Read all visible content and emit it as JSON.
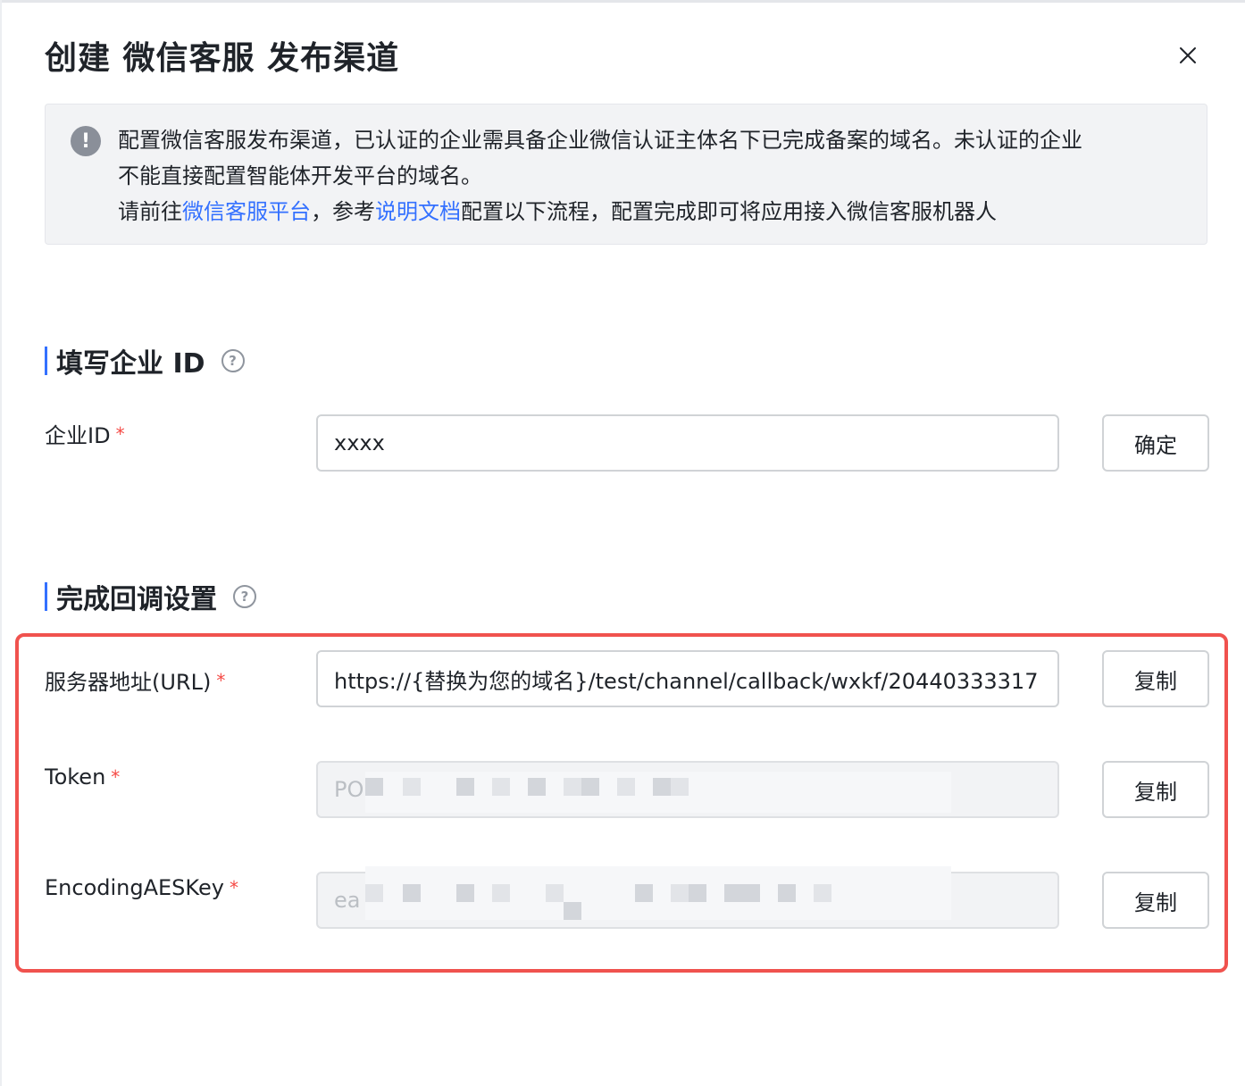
{
  "dialog": {
    "title": "创建 微信客服 发布渠道"
  },
  "notice": {
    "line1": "配置微信客服发布渠道，已认证的企业需具备企业微信认证主体名下已完成备案的域名。未认证的企业",
    "line2": "不能直接配置智能体开发平台的域名。",
    "line3_prefix": "请前往",
    "link_platform": "微信客服平台",
    "line3_mid": "，参考",
    "link_docs": "说明文档",
    "line3_suffix": "配置以下流程，配置完成即可将应用接入微信客服机器人"
  },
  "section_enterprise": {
    "title": "填写企业 ID",
    "field_label": "企业ID",
    "field_value": "xxxx",
    "confirm_label": "确定"
  },
  "section_callback": {
    "title": "完成回调设置",
    "url_label": "服务器地址(URL)",
    "url_value": "https://{替换为您的域名}/test/channel/callback/wxkf/20440333317",
    "token_label": "Token",
    "token_value_visible": "PO",
    "aes_label": "EncodingAESKey",
    "aes_value_visible": "ea",
    "copy_label": "复制"
  },
  "required_mark": "*",
  "icons": {
    "close": "close-icon",
    "notice": "exclamation-icon",
    "help": "question-icon"
  },
  "colors": {
    "link": "#3370ff",
    "section_bar": "#3370ff",
    "required": "#f54a45",
    "highlight_border": "#f0524e"
  }
}
